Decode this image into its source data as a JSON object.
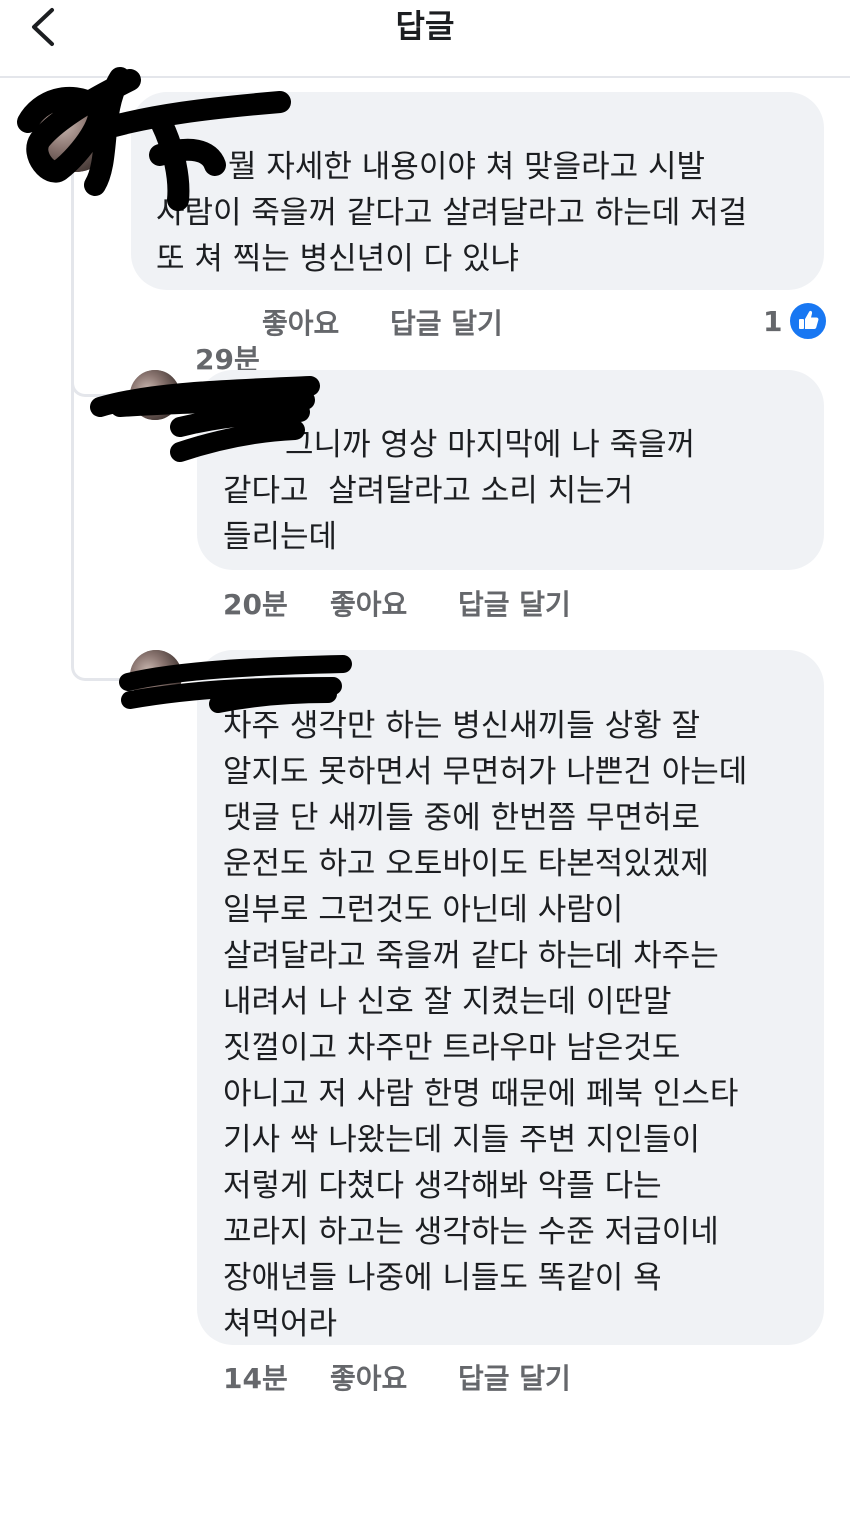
{
  "header": {
    "title": "답글",
    "back_icon": "chevron-left-icon"
  },
  "comments": [
    {
      "name_suffix": "뭘 자세한 내용이야 쳐 맞을라고 시발",
      "lines": [
        "사람이 죽을꺼 같다고 살려달라고 하는데 저걸",
        "또 쳐 찍는 병신년이 다 있냐"
      ],
      "time": "29분",
      "like_label": "좋아요",
      "reply_label": "답글 달기",
      "like_count": "1",
      "like_icon": "thumbs-up-icon"
    },
    {
      "name_suffix": "그니까 영상 마지막에 나 죽을꺼",
      "lines": [
        "같다고  살려달라고 소리 치는거",
        "들리는데"
      ],
      "time": "20분",
      "like_label": "좋아요",
      "reply_label": "답글 달기"
    },
    {
      "lines": [
        "차주 생각만 하는 병신새끼들 상황 잘",
        "알지도 못하면서 무면허가 나쁜건 아는데",
        "댓글 단 새끼들 중에 한번쯤 무면허로",
        "운전도 하고 오토바이도 타본적있겠제",
        "일부로 그런것도 아닌데 사람이",
        "살려달라고 죽을꺼 같다 하는데 차주는",
        "내려서 나 신호 잘 지켰는데 이딴말",
        "짓껄이고 차주만 트라우마 남은것도",
        "아니고 저 사람 한명 때문에 페북 인스타",
        "기사 싹 나왔는데 지들 주변 지인들이",
        "저렇게 다쳤다 생각해봐 악플 다는",
        "꼬라지 하고는 생각하는 수준 저급이네",
        "장애년들 나중에 니들도 똑같이 욕",
        "쳐먹어라"
      ],
      "time": "14분",
      "like_label": "좋아요",
      "reply_label": "답글 달기"
    }
  ],
  "colors": {
    "bubble": "#f0f2f5",
    "meta_text": "#65676b",
    "like_blue": "#1877f2",
    "redaction": "#000000"
  }
}
